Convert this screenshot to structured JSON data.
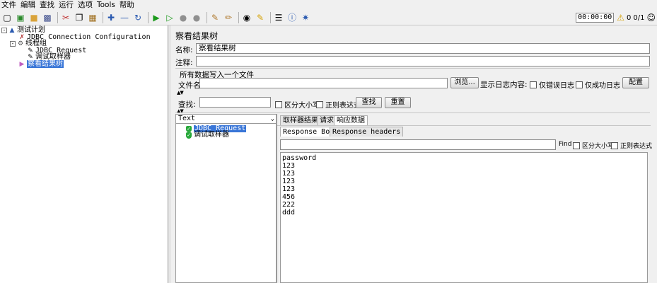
{
  "menubar": [
    "文件",
    "编辑",
    "查找",
    "运行",
    "选项",
    "Tools",
    "帮助"
  ],
  "toolbar": {
    "icons": [
      "new-icon",
      "templates-icon",
      "open-icon",
      "save-icon",
      "cut-icon",
      "copy-icon",
      "paste-icon",
      "expand-icon",
      "collapse-icon",
      "toggle-icon",
      "start-icon",
      "start-no-pause-icon",
      "stop-icon",
      "shutdown-icon",
      "clear-icon",
      "clear-all-icon",
      "search-icon",
      "reset-search-icon",
      "function-helper-icon",
      "help-icon",
      "remote-icon"
    ],
    "timer": "00:00:00",
    "warnings": "0",
    "threads": "0/1"
  },
  "tree": {
    "items": [
      {
        "label": "测试计划",
        "icon": "test-plan-icon"
      },
      {
        "label": "JDBC Connection Configuration",
        "icon": "config-icon"
      },
      {
        "label": "线程组",
        "icon": "thread-group-icon"
      },
      {
        "label": "JDBC Request",
        "icon": "sampler-icon"
      },
      {
        "label": "调试取样器",
        "icon": "sampler-icon"
      },
      {
        "label": "察看结果树",
        "icon": "listener-icon"
      }
    ]
  },
  "panel": {
    "title": "察看结果树",
    "name_label": "名称:",
    "name_value": "察看结果树",
    "comment_label": "注释:",
    "comment_value": "",
    "write_all_label": "所有数据写入一个文件",
    "filename_label": "文件名",
    "browse_label": "浏览...",
    "log_display_label": "显示日志内容:",
    "only_errors_label": "仅错误日志",
    "only_success_label": "仅成功日志",
    "configure_label": "配置",
    "search_label": "查找:",
    "case_sensitive_label": "区分大小写",
    "regex_label": "正则表达式",
    "search_button": "查找",
    "reset_button": "重置"
  },
  "results": {
    "renderer": "Text",
    "items": [
      "JDBC Request",
      "调试取样器"
    ],
    "tabs": [
      "取样器结果",
      "请求",
      "响应数据"
    ],
    "sub_tabs": [
      "Response Body",
      "Response headers"
    ],
    "find_label": "Find",
    "find_case_label": "区分大小写",
    "find_regex_label": "正则表达式",
    "body_lines": [
      "password",
      "123",
      "123",
      "123",
      "123",
      "456",
      "222",
      "ddd"
    ]
  },
  "colors": {
    "selection": "#3875d7",
    "ok": "#27a83a"
  }
}
